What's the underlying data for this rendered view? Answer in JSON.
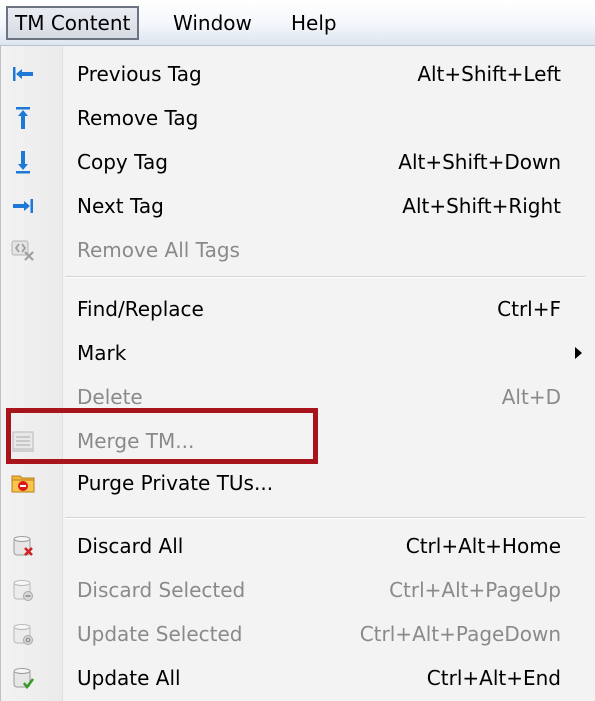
{
  "menubar": {
    "items": [
      {
        "label": "TM Content"
      },
      {
        "label": "Window"
      },
      {
        "label": "Help"
      }
    ]
  },
  "menu": {
    "items": [
      {
        "label": "Previous Tag",
        "shortcut": "Alt+Shift+Left",
        "enabled": true,
        "icon": "arrow-left-to-bar-icon"
      },
      {
        "label": "Remove Tag",
        "shortcut": "",
        "enabled": true,
        "icon": "arrow-up-to-bar-icon"
      },
      {
        "label": "Copy Tag",
        "shortcut": "Alt+Shift+Down",
        "enabled": true,
        "icon": "arrow-down-to-bar-icon"
      },
      {
        "label": "Next Tag",
        "shortcut": "Alt+Shift+Right",
        "enabled": true,
        "icon": "arrow-right-to-bar-icon"
      },
      {
        "label": "Remove All Tags",
        "shortcut": "",
        "enabled": false,
        "icon": "remove-tags-icon"
      },
      {
        "label": "Find/Replace",
        "shortcut": "Ctrl+F",
        "enabled": true,
        "icon": ""
      },
      {
        "label": "Mark",
        "shortcut": "",
        "enabled": true,
        "icon": "",
        "submenu": true
      },
      {
        "label": "Delete",
        "shortcut": "Alt+D",
        "enabled": false,
        "icon": ""
      },
      {
        "label": "Merge TM...",
        "shortcut": "",
        "enabled": false,
        "icon": "merge-tm-icon"
      },
      {
        "label": "Purge Private TUs...",
        "shortcut": "",
        "enabled": true,
        "icon": "purge-folder-icon",
        "highlighted": true
      },
      {
        "label": "Discard All",
        "shortcut": "Ctrl+Alt+Home",
        "enabled": true,
        "icon": "database-discard-icon"
      },
      {
        "label": "Discard Selected",
        "shortcut": "Ctrl+Alt+PageUp",
        "enabled": false,
        "icon": "database-discard-selected-icon"
      },
      {
        "label": "Update Selected",
        "shortcut": "Ctrl+Alt+PageDown",
        "enabled": false,
        "icon": "database-update-selected-icon"
      },
      {
        "label": "Update All",
        "shortcut": "Ctrl+Alt+End",
        "enabled": true,
        "icon": "database-update-icon"
      }
    ]
  },
  "colors": {
    "arrow_blue": "#1e78d6",
    "highlight_border": "#a8141c",
    "disabled_text": "#8a8a8a"
  }
}
